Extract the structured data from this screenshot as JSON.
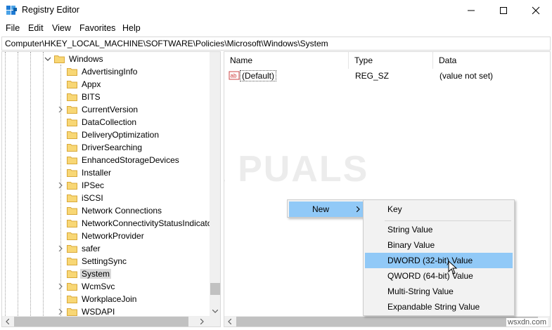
{
  "window": {
    "title": "Registry Editor"
  },
  "menubar": [
    "File",
    "Edit",
    "View",
    "Favorites",
    "Help"
  ],
  "address": "Computer\\HKEY_LOCAL_MACHINE\\SOFTWARE\\Policies\\Microsoft\\Windows\\System",
  "tree": {
    "parent": "Windows",
    "items": [
      {
        "label": "AdvertisingInfo",
        "expandable": false
      },
      {
        "label": "Appx",
        "expandable": false
      },
      {
        "label": "BITS",
        "expandable": false
      },
      {
        "label": "CurrentVersion",
        "expandable": true
      },
      {
        "label": "DataCollection",
        "expandable": false
      },
      {
        "label": "DeliveryOptimization",
        "expandable": false
      },
      {
        "label": "DriverSearching",
        "expandable": false
      },
      {
        "label": "EnhancedStorageDevices",
        "expandable": false
      },
      {
        "label": "Installer",
        "expandable": false
      },
      {
        "label": "IPSec",
        "expandable": true
      },
      {
        "label": "iSCSI",
        "expandable": false
      },
      {
        "label": "Network Connections",
        "expandable": false
      },
      {
        "label": "NetworkConnectivityStatusIndicator",
        "expandable": false
      },
      {
        "label": "NetworkProvider",
        "expandable": false
      },
      {
        "label": "safer",
        "expandable": true
      },
      {
        "label": "SettingSync",
        "expandable": false
      },
      {
        "label": "System",
        "expandable": false,
        "selected": true
      },
      {
        "label": "WcmSvc",
        "expandable": true
      },
      {
        "label": "WorkplaceJoin",
        "expandable": false
      },
      {
        "label": "WSDAPI",
        "expandable": true
      }
    ]
  },
  "list": {
    "columns": [
      "Name",
      "Type",
      "Data"
    ],
    "rows": [
      {
        "name": "(Default)",
        "type": "REG_SZ",
        "data": "(value not set)",
        "icon": "string-value-icon"
      }
    ]
  },
  "watermark": "A  PUALS",
  "context_menu": {
    "main": [
      {
        "label": "New",
        "has_submenu": true
      }
    ],
    "submenu": [
      {
        "label": "Key"
      },
      {
        "label": "String Value"
      },
      {
        "label": "Binary Value"
      },
      {
        "label": "DWORD (32-bit) Value",
        "highlighted": true
      },
      {
        "label": "QWORD (64-bit) Value"
      },
      {
        "label": "Multi-String Value"
      },
      {
        "label": "Expandable String Value"
      }
    ]
  },
  "credit": "wsxdn.com",
  "colors": {
    "selection": "#d9d9d9",
    "menu_highlight": "#91c9f7",
    "folder": "#f8d775"
  }
}
